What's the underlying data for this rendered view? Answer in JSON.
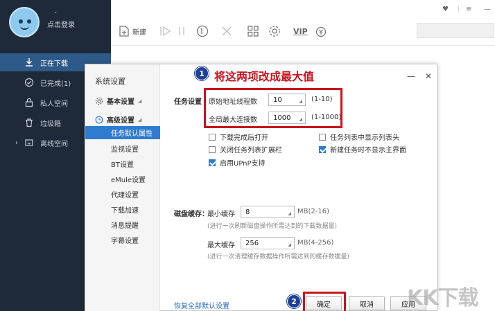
{
  "app": {
    "user": {
      "name": "·",
      "login_label": "点击登录"
    },
    "nav": [
      {
        "label": "正在下载",
        "icon": "download-icon",
        "active": true
      },
      {
        "label": "已完成(1)",
        "icon": "check-circle-icon",
        "active": false
      },
      {
        "label": "私人空间",
        "icon": "lock-icon",
        "active": false
      },
      {
        "label": "垃圾箱",
        "icon": "trash-icon",
        "active": false
      },
      {
        "label": "离线空间",
        "icon": "cloud-icon",
        "active": false,
        "collapsible": true
      }
    ],
    "toolbar": {
      "new_label": "新建",
      "vip_label": "VIP"
    }
  },
  "dialog": {
    "title": "系统设置",
    "groups": {
      "basic": "基本设置",
      "advanced": "高级设置"
    },
    "sub_items": [
      "任务默认属性",
      "监视设置",
      "BT设置",
      "eMule设置",
      "代理设置",
      "下载加速",
      "消息提醒",
      "字幕设置"
    ],
    "active_sub": "任务默认属性",
    "task_settings": {
      "section_label": "任务设置",
      "threads_label": "原始地址线程数",
      "threads_value": "10",
      "threads_range": "(1-10)",
      "connections_label": "全局最大连接数",
      "connections_value": "1000",
      "connections_range": "(1-1000)"
    },
    "options": [
      {
        "label": "下载完成后打开",
        "checked": false
      },
      {
        "label": "任务列表中显示列表头",
        "checked": false
      },
      {
        "label": "关闭任务列表扩展栏",
        "checked": false
      },
      {
        "label": "新建任务时不显示主界面",
        "checked": true
      },
      {
        "label": "启用UPnP支持",
        "checked": true
      }
    ],
    "disk_cache": {
      "section_label": "磁盘缓存：",
      "min_label": "最小缓存",
      "min_value": "8",
      "min_range": "MB(2-16)",
      "min_hint": "(进行一次刷新磁盘操作所需达到的下载数据量)",
      "max_label": "最大缓存",
      "max_value": "256",
      "max_range": "MB(4-256)",
      "max_hint": "(进行一次清理缓存数据操作所需达到的缓存数据量)"
    },
    "restore_link": "恢复全部默认设置",
    "buttons": {
      "ok": "确定",
      "cancel": "取消",
      "apply": "应用"
    }
  },
  "annotations": {
    "step1_number": "1",
    "step1_text": "将这两项改成最大值",
    "step2_number": "2",
    "highlight_color": "#c8141e",
    "badge_color": "#1d3f9a"
  },
  "watermark": "KK下载"
}
